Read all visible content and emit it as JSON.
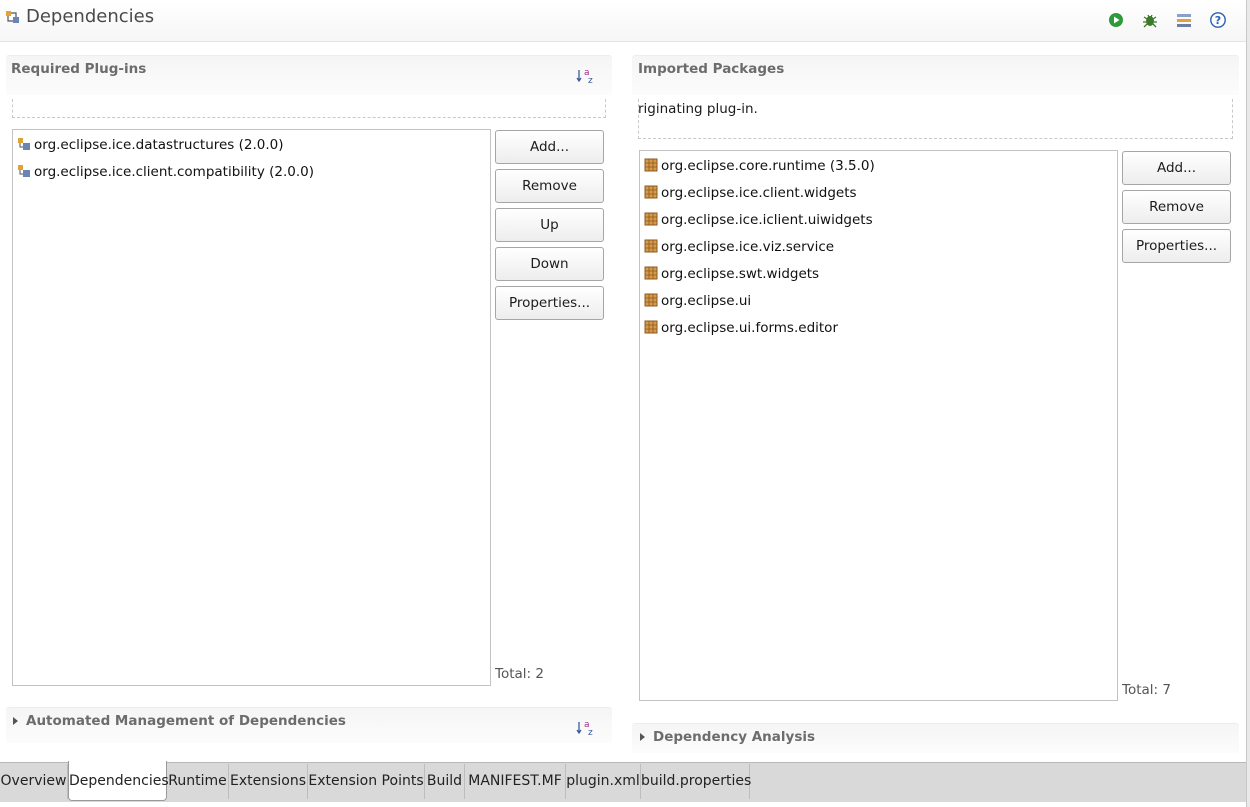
{
  "header": {
    "title": "Dependencies",
    "title_icon": "dependencies-icon",
    "actions": [
      {
        "icon": "run-icon",
        "color": "#2e9a3a"
      },
      {
        "icon": "debug-icon",
        "color": "#3a7a2a"
      },
      {
        "icon": "manage-icon",
        "color": "#6a7fa8"
      },
      {
        "icon": "help-icon",
        "color": "#2b5fb8"
      }
    ]
  },
  "required_plugins": {
    "title": "Required Plug-ins",
    "sort_icon": "sort-alphabetical-icon",
    "items": [
      "org.eclipse.ice.datastructures (2.0.0)",
      "org.eclipse.ice.client.compatibility (2.0.0)"
    ],
    "buttons": {
      "add": "Add...",
      "remove": "Remove",
      "up": "Up",
      "down": "Down",
      "properties": "Properties..."
    },
    "total": "Total: 2"
  },
  "imported_packages": {
    "title": "Imported Packages",
    "description": "riginating plug-in.",
    "items": [
      "org.eclipse.core.runtime (3.5.0)",
      "org.eclipse.ice.client.widgets",
      "org.eclipse.ice.iclient.uiwidgets",
      "org.eclipse.ice.viz.service",
      "org.eclipse.swt.widgets",
      "org.eclipse.ui",
      "org.eclipse.ui.forms.editor"
    ],
    "buttons": {
      "add": "Add...",
      "remove": "Remove",
      "properties": "Properties..."
    },
    "total": "Total: 7"
  },
  "automated_management": {
    "title": "Automated Management of Dependencies"
  },
  "dependency_analysis": {
    "title": "Dependency Analysis"
  },
  "tabs": [
    {
      "label": "Overview",
      "active": false
    },
    {
      "label": "Dependencies",
      "active": true
    },
    {
      "label": "Runtime",
      "active": false
    },
    {
      "label": "Extensions",
      "active": false
    },
    {
      "label": "Extension Points",
      "active": false
    },
    {
      "label": "Build",
      "active": false
    },
    {
      "label": "MANIFEST.MF",
      "active": false
    },
    {
      "label": "plugin.xml",
      "active": false
    },
    {
      "label": "build.properties",
      "active": false
    }
  ]
}
